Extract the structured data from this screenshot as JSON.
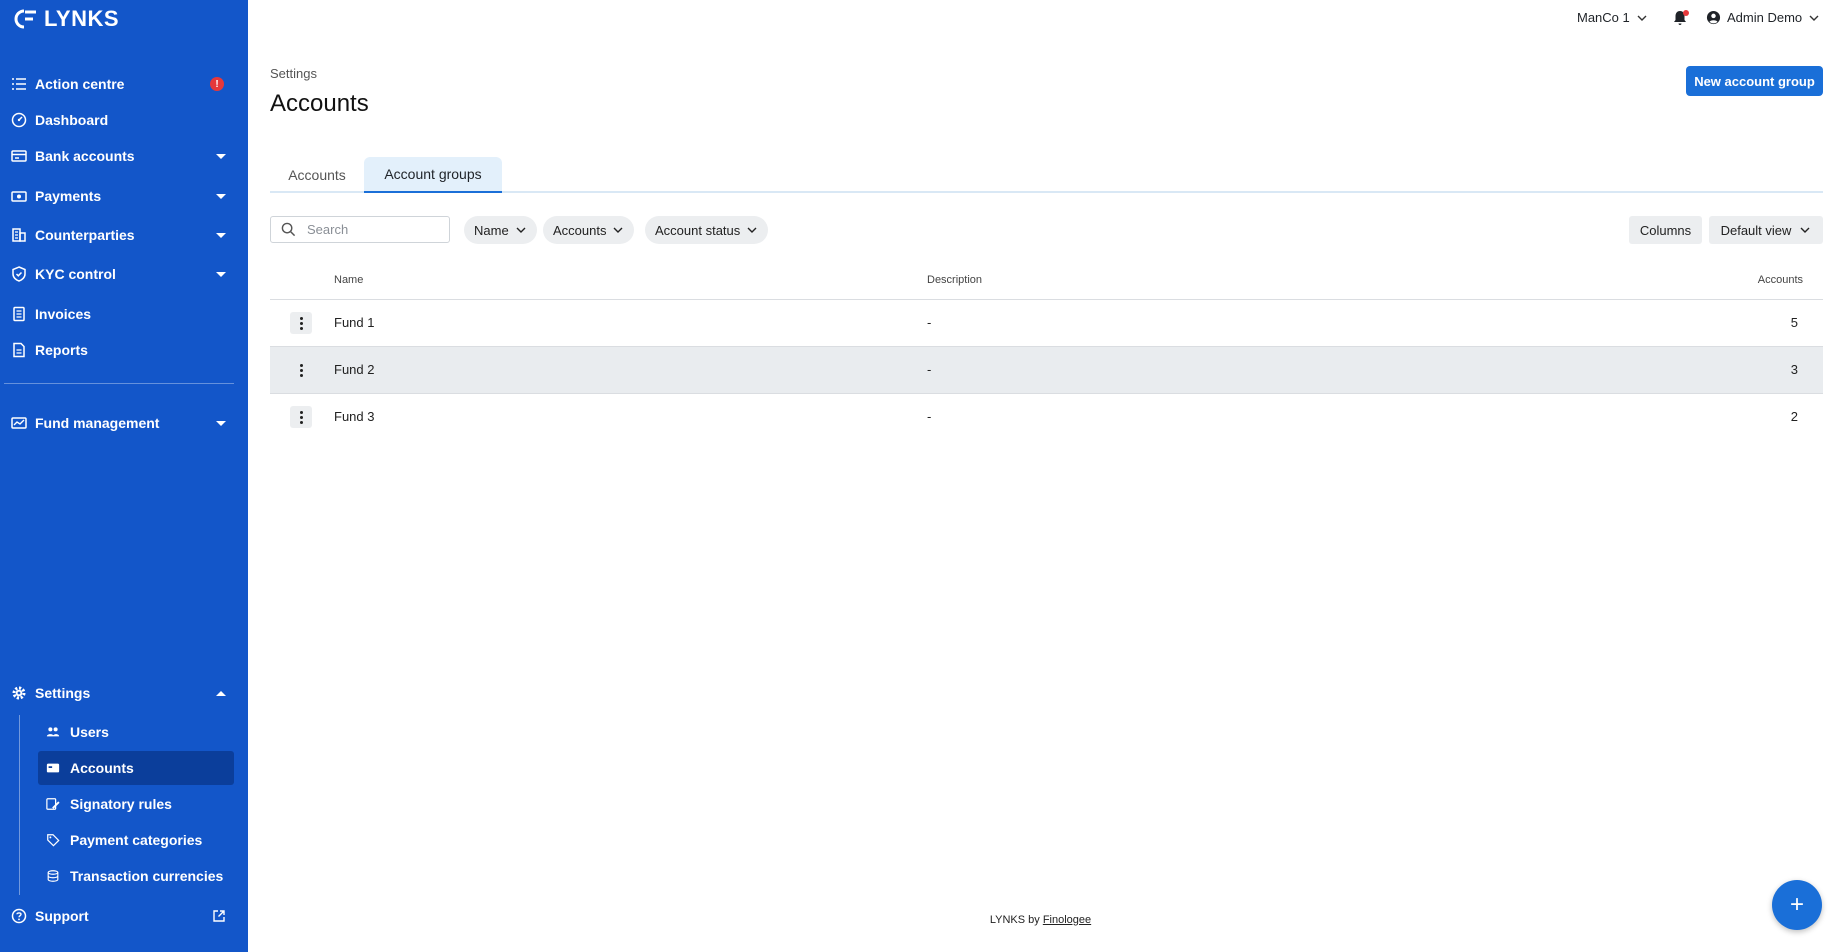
{
  "brand": {
    "name": "LYNKS"
  },
  "sidebar": {
    "items": [
      {
        "label": "Action centre",
        "icon": "list-check-icon",
        "badge": "!"
      },
      {
        "label": "Dashboard",
        "icon": "gauge-icon"
      },
      {
        "label": "Bank accounts",
        "icon": "bank-card-icon"
      },
      {
        "label": "Payments",
        "icon": "money-icon"
      },
      {
        "label": "Counterparties",
        "icon": "buildings-icon"
      },
      {
        "label": "KYC control",
        "icon": "shield-check-icon"
      },
      {
        "label": "Invoices",
        "icon": "invoice-icon"
      },
      {
        "label": "Reports",
        "icon": "report-icon"
      },
      {
        "label": "Fund management",
        "icon": "fund-icon"
      },
      {
        "label": "Settings",
        "icon": "gear-icon"
      },
      {
        "label": "Support",
        "icon": "help-circle-icon"
      }
    ],
    "settings_children": [
      {
        "label": "Users",
        "icon": "users-icon"
      },
      {
        "label": "Accounts",
        "icon": "account-card-icon",
        "active": true
      },
      {
        "label": "Signatory rules",
        "icon": "signature-icon"
      },
      {
        "label": "Payment categories",
        "icon": "tag-icon"
      },
      {
        "label": "Transaction currencies",
        "icon": "coins-icon"
      }
    ]
  },
  "topbar": {
    "company": "ManCo 1",
    "user": "Admin Demo"
  },
  "page": {
    "breadcrumb": "Settings",
    "title": "Accounts",
    "primary_action": "New account group"
  },
  "tabs": [
    {
      "label": "Accounts",
      "active": false
    },
    {
      "label": "Account groups",
      "active": true
    }
  ],
  "filters": {
    "search_placeholder": "Search",
    "pills": [
      "Name",
      "Accounts",
      "Account status"
    ],
    "columns_label": "Columns",
    "view_label": "Default view"
  },
  "table": {
    "headers": {
      "name": "Name",
      "description": "Description",
      "accounts": "Accounts"
    },
    "rows": [
      {
        "name": "Fund 1",
        "description": "-",
        "accounts": "5"
      },
      {
        "name": "Fund 2",
        "description": "-",
        "accounts": "3"
      },
      {
        "name": "Fund 3",
        "description": "-",
        "accounts": "2"
      }
    ]
  },
  "footer": {
    "prefix": "LYNKS by",
    "link": "Finologee"
  },
  "fab": {
    "label": "+"
  },
  "colors": {
    "sidebar": "#1356c9",
    "primary": "#1a6fd8",
    "alert": "#e5383b"
  }
}
